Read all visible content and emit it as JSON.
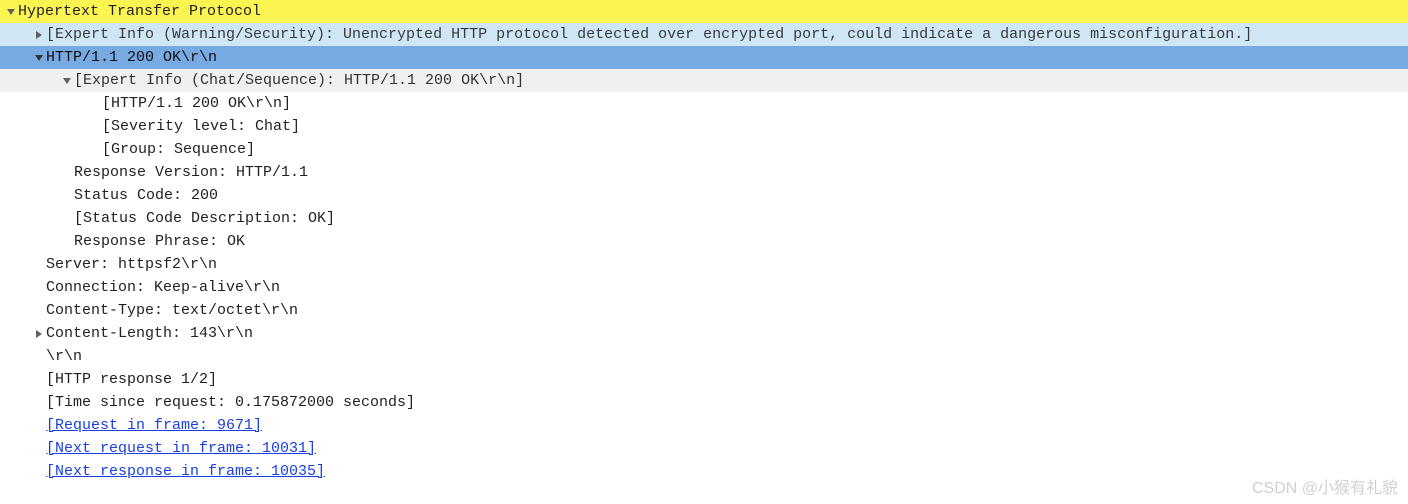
{
  "root": {
    "label": "Hypertext Transfer Protocol",
    "expert_warning": "[Expert Info (Warning/Security): Unencrypted HTTP protocol detected over encrypted port, could indicate a dangerous misconfiguration.]",
    "status_line": "HTTP/1.1 200 OK\\r\\n",
    "expert_chat": {
      "title": "[Expert Info (Chat/Sequence): HTTP/1.1 200 OK\\r\\n]",
      "detail1": "[HTTP/1.1 200 OK\\r\\n]",
      "detail2": "[Severity level: Chat]",
      "detail3": "[Group: Sequence]"
    },
    "response_version": "Response Version: HTTP/1.1",
    "status_code": "Status Code: 200",
    "status_code_desc": "[Status Code Description: OK]",
    "response_phrase": "Response Phrase: OK",
    "server": "Server: httpsf2\\r\\n",
    "connection": "Connection: Keep-alive\\r\\n",
    "content_type": "Content-Type: text/octet\\r\\n",
    "content_length": "Content-Length: 143\\r\\n",
    "crlf": "\\r\\n",
    "http_response": "[HTTP response 1/2]",
    "time_since": "[Time since request: 0.175872000 seconds]",
    "req_frame": "[Request in frame: 9671]",
    "next_req_frame": "[Next request in frame: 10031]",
    "next_resp_frame": "[Next response in frame: 10035]"
  },
  "watermark": "CSDN @小猴有礼貌"
}
